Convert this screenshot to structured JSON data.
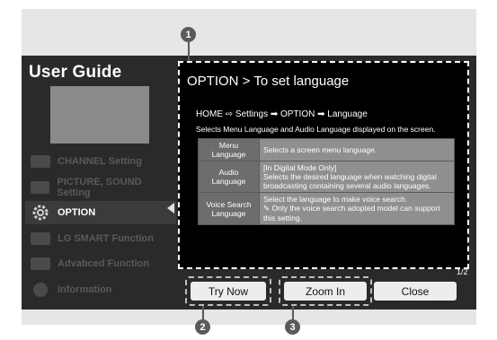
{
  "guide": {
    "title": "User Guide"
  },
  "menu": {
    "items": [
      {
        "label": "CHANNEL Setting",
        "icon": "channel-icon"
      },
      {
        "label": "PICTURE, SOUND Setting",
        "icon": "picture-sound-icon"
      },
      {
        "label": "OPTION",
        "icon": "gear-icon",
        "active": true
      },
      {
        "label": "LG SMART Function",
        "icon": "smart-icon"
      },
      {
        "label": "Advabced Function",
        "icon": "advanced-icon"
      },
      {
        "label": "Information",
        "icon": "info-icon"
      }
    ]
  },
  "content": {
    "title": "OPTION > To set language",
    "breadcrumb": "HOME ⇨ Settings ➡ OPTION ➡ Language",
    "description": "Selects Menu Language and Audio Language displayed on the screen.",
    "rows": [
      {
        "key": "Menu\nLanguage",
        "value": "Selects a screen menu language."
      },
      {
        "key": "Audio\nLanguage",
        "value": "[In Digital Mode Only]\nSelects the desired language when watching digital broadcasting containing several audio languages."
      },
      {
        "key": "Voice Search\nLanguage",
        "value": "Select the language to make voice search.\n✎ Only the voice search adopted model can support this setting."
      }
    ],
    "page": "1/2"
  },
  "buttons": {
    "try_now": "Try Now",
    "zoom_in": "Zoom In",
    "close": "Close"
  },
  "markers": {
    "m1": "1",
    "m2": "2",
    "m3": "3"
  },
  "colors": {
    "screen_bg": "#2a2a2a",
    "content_bg": "#000000",
    "marker": "#5a5a5a",
    "button_bg": "#ededed"
  }
}
